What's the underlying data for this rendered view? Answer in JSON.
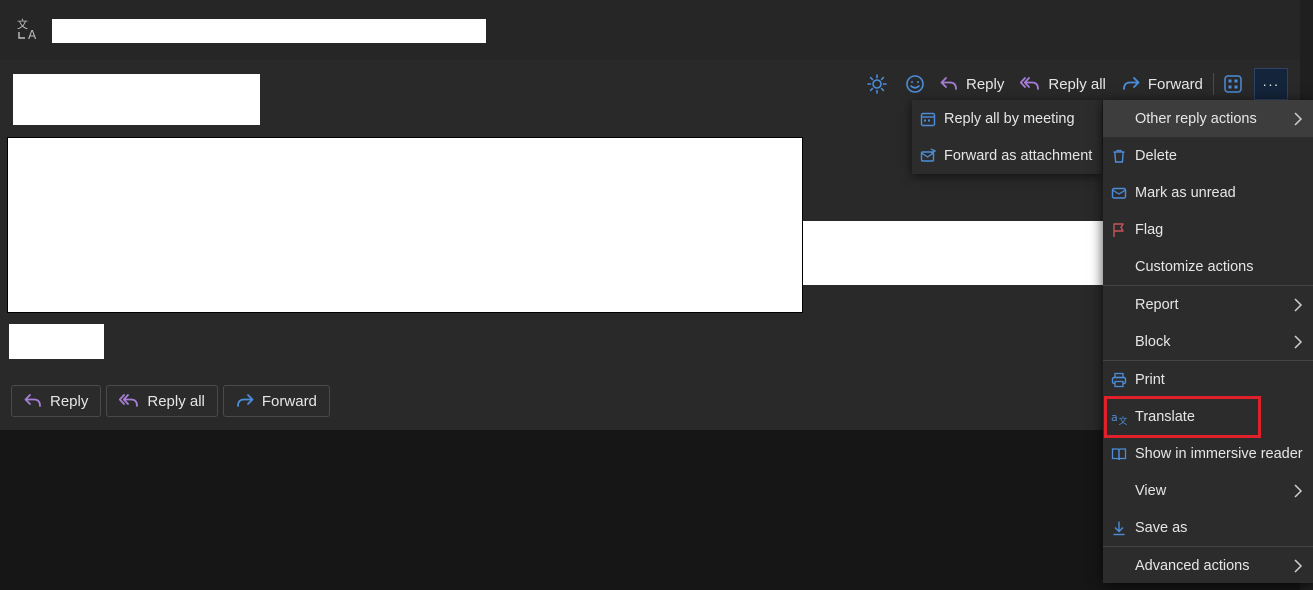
{
  "toolbar": {
    "reply_label": "Reply",
    "reply_all_label": "Reply all",
    "forward_label": "Forward",
    "more_label": "···"
  },
  "bottom_actions": {
    "reply_label": "Reply",
    "reply_all_label": "Reply all",
    "forward_label": "Forward"
  },
  "submenu": {
    "items": [
      {
        "label": "Reply all by meeting",
        "icon": "calendar-reply-icon"
      },
      {
        "label": "Forward as attachment",
        "icon": "mail-forward-icon"
      }
    ]
  },
  "menu": {
    "items": [
      {
        "label": "Other reply actions",
        "icon": "",
        "has_submenu": true
      },
      {
        "label": "Delete",
        "icon": "trash-icon"
      },
      {
        "label": "Mark as unread",
        "icon": "envelope-icon"
      },
      {
        "label": "Flag",
        "icon": "flag-icon"
      },
      {
        "label": "Customize actions",
        "icon": ""
      },
      {
        "label": "Report",
        "icon": "",
        "has_submenu": true
      },
      {
        "label": "Block",
        "icon": "",
        "has_submenu": true
      },
      {
        "label": "Print",
        "icon": "printer-icon"
      },
      {
        "label": "Translate",
        "icon": "translate-icon"
      },
      {
        "label": "Show in immersive reader",
        "icon": "immersive-reader-icon"
      },
      {
        "label": "View",
        "icon": "",
        "has_submenu": true
      },
      {
        "label": "Save as",
        "icon": "download-icon"
      },
      {
        "label": "Advanced actions",
        "icon": "",
        "has_submenu": true
      }
    ]
  },
  "colors": {
    "accent_blue": "#4c8dd9",
    "reply_purple": "#a77ed6",
    "highlight_red": "#e0202a",
    "flag_red": "#c4545a"
  }
}
